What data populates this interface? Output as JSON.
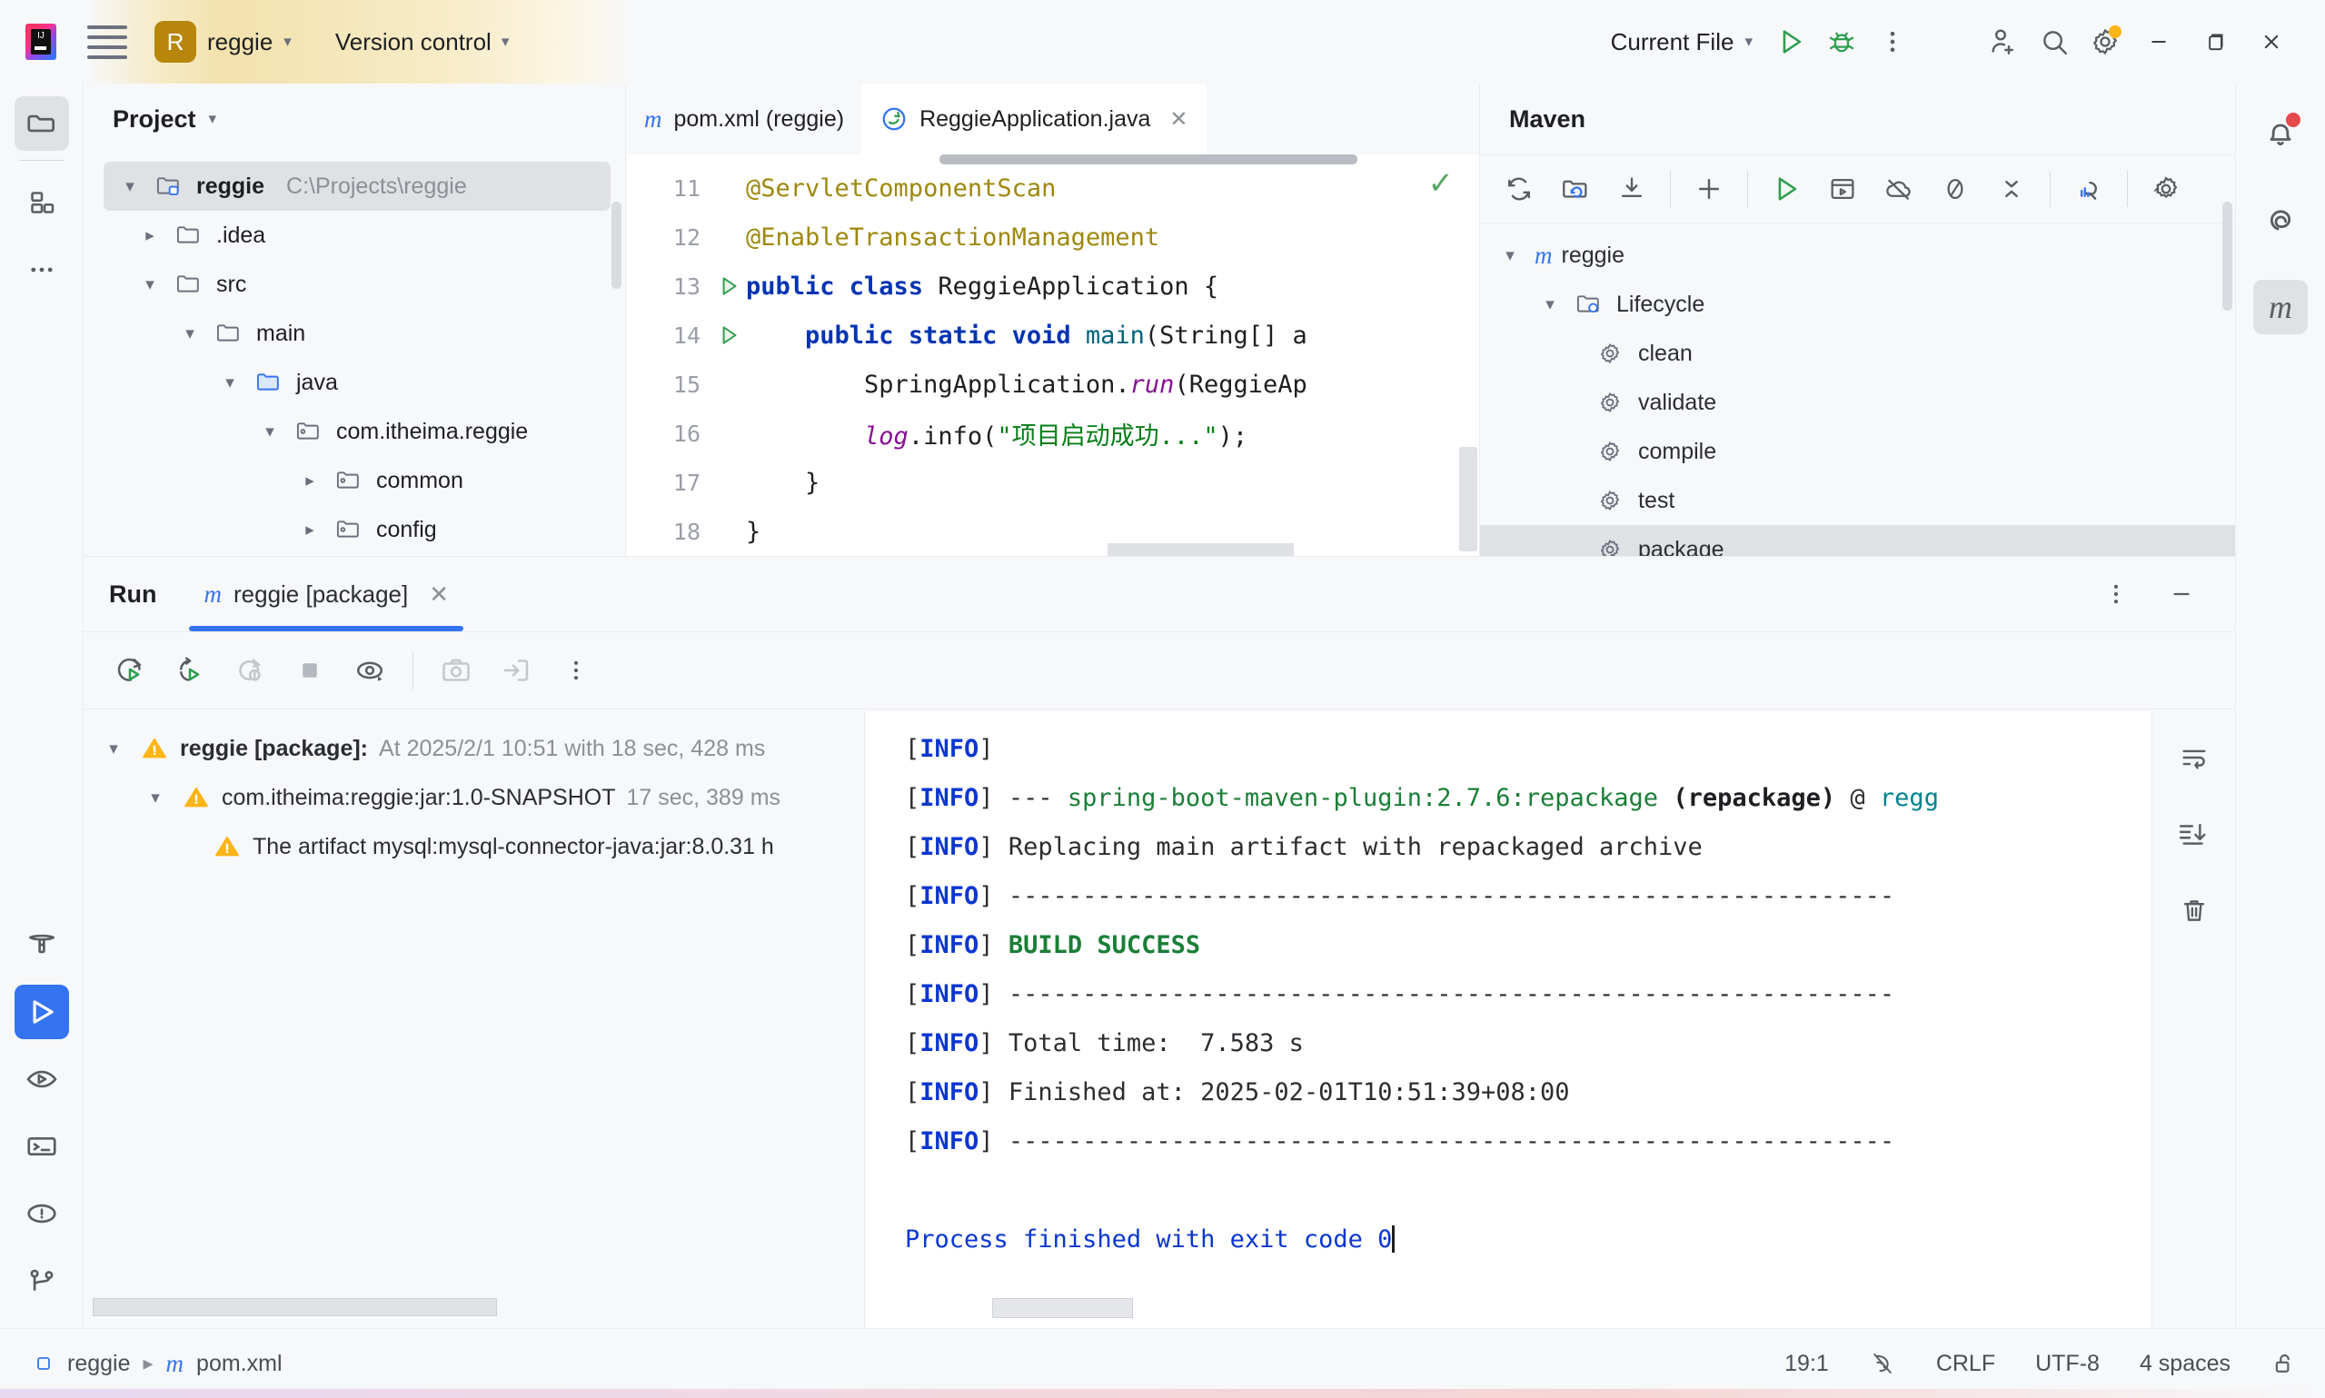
{
  "titlebar": {
    "project_badge": "R",
    "project_name": "reggie",
    "version_control": "Version control",
    "run_config": "Current File",
    "icons": {
      "logo": "intellij-idea-logo",
      "menu": "hamburger-menu-icon",
      "run": "run-icon",
      "debug": "debug-icon",
      "more": "more-vertical-icon",
      "share": "add-user-icon",
      "search": "search-icon",
      "settings": "settings-gear-icon",
      "minimize": "minimize-icon",
      "maximize": "maximize-icon",
      "close": "close-icon"
    }
  },
  "left_stripe": {
    "items": [
      {
        "name": "project-tool-window",
        "icon": "folder-icon",
        "active": true
      },
      {
        "name": "structure-tool-window",
        "icon": "structure-icon",
        "active": false
      },
      {
        "name": "more-tool-windows",
        "icon": "more-horizontal-icon",
        "active": false
      }
    ],
    "bottom_items": [
      {
        "name": "build-tool-window",
        "icon": "hammer-icon",
        "active": false
      },
      {
        "name": "run-tool-window",
        "icon": "run-icon",
        "active": true
      },
      {
        "name": "debug-tool-window",
        "icon": "debug-run-icon",
        "active": false
      },
      {
        "name": "terminal-tool-window",
        "icon": "terminal-icon",
        "active": false
      },
      {
        "name": "problems-tool-window",
        "icon": "warning-circle-icon",
        "active": false
      },
      {
        "name": "version-control-tool-window",
        "icon": "git-branch-icon",
        "active": false
      }
    ]
  },
  "right_stripe": {
    "items": [
      {
        "name": "notifications",
        "icon": "bell-icon",
        "badge": true
      },
      {
        "name": "ai-assistant",
        "icon": "spiral-icon",
        "badge": false
      },
      {
        "name": "maven-tool-window",
        "icon": "maven-m-icon",
        "badge": false,
        "active": true
      }
    ]
  },
  "project_panel": {
    "title": "Project",
    "tree": [
      {
        "label": "reggie",
        "path": "C:\\Projects\\reggie",
        "depth": 0,
        "twisty": "down",
        "icon": "module-folder-icon",
        "selected": true,
        "bold": true
      },
      {
        "label": ".idea",
        "path": "",
        "depth": 1,
        "twisty": "right",
        "icon": "folder-icon",
        "selected": false,
        "bold": false
      },
      {
        "label": "src",
        "path": "",
        "depth": 1,
        "twisty": "down",
        "icon": "folder-icon",
        "selected": false,
        "bold": false
      },
      {
        "label": "main",
        "path": "",
        "depth": 2,
        "twisty": "down",
        "icon": "folder-icon",
        "selected": false,
        "bold": false
      },
      {
        "label": "java",
        "path": "",
        "depth": 3,
        "twisty": "down",
        "icon": "source-folder-icon",
        "selected": false,
        "bold": false
      },
      {
        "label": "com.itheima.reggie",
        "path": "",
        "depth": 4,
        "twisty": "down",
        "icon": "package-icon",
        "selected": false,
        "bold": false
      },
      {
        "label": "common",
        "path": "",
        "depth": 5,
        "twisty": "right",
        "icon": "package-icon",
        "selected": false,
        "bold": false
      },
      {
        "label": "config",
        "path": "",
        "depth": 5,
        "twisty": "right",
        "icon": "package-icon",
        "selected": false,
        "bold": false
      }
    ]
  },
  "editor": {
    "tabs": [
      {
        "label": "pom.xml (reggie)",
        "icon": "maven-m-icon",
        "active": false,
        "closable": false
      },
      {
        "label": "ReggieApplication.java",
        "icon": "spring-boot-icon",
        "active": true,
        "closable": true
      }
    ],
    "inspection_status": "ok",
    "lines": [
      {
        "num": "11",
        "runmark": false,
        "segments": [
          {
            "t": "@ServletComponentScan",
            "c": "ann"
          }
        ],
        "indent": 0
      },
      {
        "num": "12",
        "runmark": false,
        "segments": [
          {
            "t": "@EnableTransactionManagement",
            "c": "ann"
          }
        ],
        "indent": 0
      },
      {
        "num": "13",
        "runmark": true,
        "segments": [
          {
            "t": "public class ",
            "c": "kw"
          },
          {
            "t": "ReggieApplication {",
            "c": "cls"
          }
        ],
        "indent": 0
      },
      {
        "num": "14",
        "runmark": true,
        "segments": [
          {
            "t": "public static void ",
            "c": "kw"
          },
          {
            "t": "main",
            "c": "mth"
          },
          {
            "t": "(String[] a",
            "c": "cls"
          }
        ],
        "indent": 1
      },
      {
        "num": "15",
        "runmark": false,
        "segments": [
          {
            "t": "SpringApplication.",
            "c": "cls"
          },
          {
            "t": "run",
            "c": "fld"
          },
          {
            "t": "(ReggieAp",
            "c": "cls"
          }
        ],
        "indent": 2
      },
      {
        "num": "16",
        "runmark": false,
        "segments": [
          {
            "t": "log",
            "c": "fld"
          },
          {
            "t": ".info(",
            "c": "cls"
          },
          {
            "t": "\"项目启动成功...\"",
            "c": "str"
          },
          {
            "t": ");",
            "c": "cls"
          }
        ],
        "indent": 2
      },
      {
        "num": "17",
        "runmark": false,
        "segments": [
          {
            "t": "}",
            "c": "cls"
          }
        ],
        "indent": 1
      },
      {
        "num": "18",
        "runmark": false,
        "segments": [
          {
            "t": "}",
            "c": "cls"
          }
        ],
        "indent": 0
      }
    ]
  },
  "maven_panel": {
    "title": "Maven",
    "toolbar": [
      {
        "name": "reload-all-maven-projects-button",
        "icon": "refresh-icon"
      },
      {
        "name": "reimport-button",
        "icon": "folder-refresh-icon"
      },
      {
        "name": "download-sources-button",
        "icon": "download-icon"
      },
      {
        "name": "add-maven-project-button",
        "icon": "plus-icon"
      },
      {
        "name": "run-maven-build-button",
        "icon": "run-icon"
      },
      {
        "name": "execute-maven-goal-button",
        "icon": "terminal-window-icon"
      },
      {
        "name": "toggle-offline-mode-button",
        "icon": "cloud-off-icon"
      },
      {
        "name": "skip-tests-button",
        "icon": "circle-slash-icon"
      },
      {
        "name": "collapse-all-button",
        "icon": "collapse-all-icon"
      },
      {
        "name": "show-dependencies-button",
        "icon": "analyze-dependencies-icon"
      },
      {
        "name": "maven-settings-button",
        "icon": "settings-gear-icon"
      }
    ],
    "tree": [
      {
        "label": "reggie",
        "depth": 0,
        "twisty": "down",
        "icon": "maven-m-icon",
        "highlighted": false
      },
      {
        "label": "Lifecycle",
        "depth": 1,
        "twisty": "down",
        "icon": "lifecycle-folder-icon",
        "highlighted": false
      },
      {
        "label": "clean",
        "depth": 2,
        "twisty": "none",
        "icon": "goal-gear-icon",
        "highlighted": false
      },
      {
        "label": "validate",
        "depth": 2,
        "twisty": "none",
        "icon": "goal-gear-icon",
        "highlighted": false
      },
      {
        "label": "compile",
        "depth": 2,
        "twisty": "none",
        "icon": "goal-gear-icon",
        "highlighted": false
      },
      {
        "label": "test",
        "depth": 2,
        "twisty": "none",
        "icon": "goal-gear-icon",
        "highlighted": false
      },
      {
        "label": "package",
        "depth": 2,
        "twisty": "none",
        "icon": "goal-gear-icon",
        "highlighted": true
      }
    ]
  },
  "run_panel": {
    "title": "Run",
    "tab": {
      "label": "reggie [package]",
      "icon": "maven-m-icon",
      "closable": true
    },
    "header_buttons": [
      {
        "name": "run-panel-options-button",
        "icon": "more-vertical-icon"
      },
      {
        "name": "hide-run-panel-button",
        "icon": "minimize-icon"
      }
    ],
    "toolbar": [
      {
        "name": "rerun-button",
        "icon": "rerun-icon",
        "enabled": true
      },
      {
        "name": "rerun-failed-tests-button",
        "icon": "rerun-failed-icon",
        "enabled": true
      },
      {
        "name": "restart-button",
        "icon": "restart-warning-icon",
        "enabled": false
      },
      {
        "name": "stop-button",
        "icon": "stop-square-icon",
        "enabled": true
      },
      {
        "name": "toggle-auto-test-button",
        "icon": "eye-icon",
        "enabled": true
      },
      {
        "name": "export-test-results-button",
        "icon": "camera-icon",
        "enabled": false
      },
      {
        "name": "import-test-results-button",
        "icon": "import-arrow-icon",
        "enabled": false
      },
      {
        "name": "run-more-options-button",
        "icon": "more-vertical-icon",
        "enabled": true
      }
    ],
    "tree": [
      {
        "depth": 0,
        "twisty": "down",
        "icon": "warning-triangle-icon",
        "label": "reggie [package]:",
        "bold": true,
        "meta": "At 2025/2/1 10:51 with 18 sec, 428 ms"
      },
      {
        "depth": 1,
        "twisty": "down",
        "icon": "warning-triangle-icon",
        "label": "com.itheima:reggie:jar:1.0-SNAPSHOT",
        "bold": false,
        "meta": "17 sec, 389 ms"
      },
      {
        "depth": 2,
        "twisty": "none",
        "icon": "warning-triangle-icon",
        "label": "The artifact mysql:mysql-connector-java:jar:8.0.31 h",
        "bold": false,
        "meta": ""
      }
    ],
    "console_lines": [
      {
        "segments": [
          {
            "t": "[",
            "c": "plain"
          },
          {
            "t": "INFO",
            "c": "info"
          },
          {
            "t": "] ",
            "c": "plain"
          }
        ]
      },
      {
        "segments": [
          {
            "t": "[",
            "c": "plain"
          },
          {
            "t": "INFO",
            "c": "info"
          },
          {
            "t": "] ",
            "c": "plain"
          },
          {
            "t": "--- ",
            "c": "plain"
          },
          {
            "t": "spring-boot-maven-plugin:2.7.6:repackage ",
            "c": "green"
          },
          {
            "t": "(repackage)",
            "c": "bold"
          },
          {
            "t": " @ ",
            "c": "plain"
          },
          {
            "t": "regg",
            "c": "teal"
          }
        ]
      },
      {
        "segments": [
          {
            "t": "[",
            "c": "plain"
          },
          {
            "t": "INFO",
            "c": "info"
          },
          {
            "t": "] ",
            "c": "plain"
          },
          {
            "t": "Replacing main artifact with repackaged archive",
            "c": "plain"
          }
        ]
      },
      {
        "segments": [
          {
            "t": "[",
            "c": "plain"
          },
          {
            "t": "INFO",
            "c": "info"
          },
          {
            "t": "] ",
            "c": "plain"
          },
          {
            "t": "------------------------------------------------------------",
            "c": "plain"
          }
        ]
      },
      {
        "segments": [
          {
            "t": "[",
            "c": "plain"
          },
          {
            "t": "INFO",
            "c": "info"
          },
          {
            "t": "] ",
            "c": "plain"
          },
          {
            "t": "BUILD SUCCESS",
            "c": "green"
          }
        ]
      },
      {
        "segments": [
          {
            "t": "[",
            "c": "plain"
          },
          {
            "t": "INFO",
            "c": "info"
          },
          {
            "t": "] ",
            "c": "plain"
          },
          {
            "t": "------------------------------------------------------------",
            "c": "plain"
          }
        ]
      },
      {
        "segments": [
          {
            "t": "[",
            "c": "plain"
          },
          {
            "t": "INFO",
            "c": "info"
          },
          {
            "t": "] ",
            "c": "plain"
          },
          {
            "t": "Total time:  7.583 s",
            "c": "plain"
          }
        ]
      },
      {
        "segments": [
          {
            "t": "[",
            "c": "plain"
          },
          {
            "t": "INFO",
            "c": "info"
          },
          {
            "t": "] ",
            "c": "plain"
          },
          {
            "t": "Finished at: 2025-02-01T10:51:39+08:00",
            "c": "plain"
          }
        ]
      },
      {
        "segments": [
          {
            "t": "[",
            "c": "plain"
          },
          {
            "t": "INFO",
            "c": "info"
          },
          {
            "t": "] ",
            "c": "plain"
          },
          {
            "t": "------------------------------------------------------------",
            "c": "plain"
          }
        ]
      },
      {
        "segments": []
      },
      {
        "segments": [
          {
            "t": "Process finished with exit code 0",
            "c": "blue"
          },
          {
            "t": "CARET",
            "c": "caret"
          }
        ]
      }
    ],
    "console_side_buttons": [
      {
        "name": "soft-wrap-button",
        "icon": "wrap-text-icon"
      },
      {
        "name": "scroll-to-end-button",
        "icon": "scroll-to-end-icon"
      },
      {
        "name": "clear-console-button",
        "icon": "trash-icon"
      }
    ]
  },
  "statusbar": {
    "breadcrumb": [
      {
        "label": "reggie",
        "icon": "module-icon"
      },
      {
        "label": "pom.xml",
        "icon": "maven-m-icon"
      }
    ],
    "caret_position": "19:1",
    "inspections_icon": "inspections-off-icon",
    "line_separator": "CRLF",
    "encoding": "UTF-8",
    "indent": "4 spaces",
    "lock_icon": "unlocked-icon"
  },
  "colors": {
    "accent_blue": "#3574f0",
    "warn_yellow": "#fdb515",
    "success_green": "#1a7f37",
    "badge_gold": "#b8860b",
    "panel_bg": "#f7f8fa",
    "editor_bg": "#ffffff"
  }
}
